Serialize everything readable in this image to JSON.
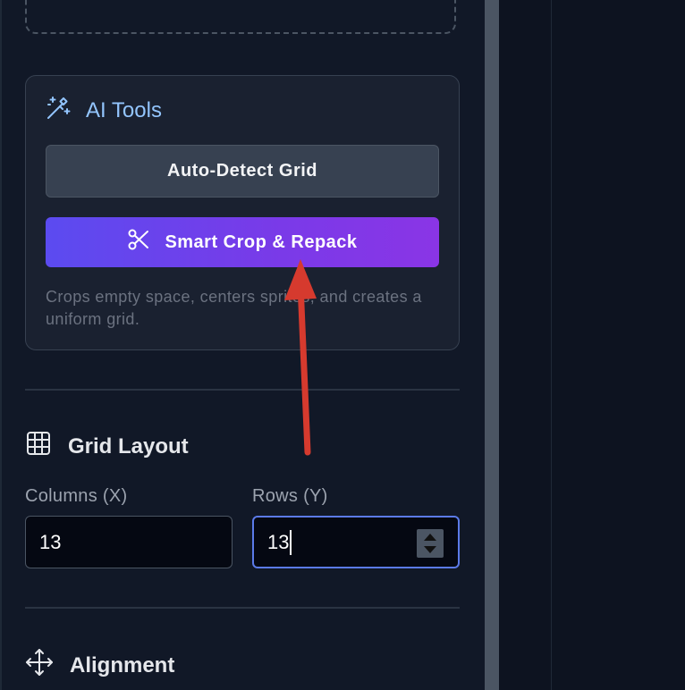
{
  "ai_tools": {
    "title": "AI Tools",
    "detect_label": "Auto-Detect Grid",
    "smart_label": "Smart Crop & Repack",
    "description": "Crops empty space, centers sprites, and creates a uniform grid."
  },
  "grid_layout": {
    "title": "Grid Layout",
    "columns_label": "Columns (X)",
    "columns_value": "13",
    "rows_label": "Rows (Y)",
    "rows_value": "13"
  },
  "alignment": {
    "title": "Alignment"
  },
  "icons": {
    "ai": "magic-wand-icon",
    "scissors": "scissors-icon",
    "grid": "grid-icon",
    "alignment": "move-icon"
  },
  "colors": {
    "accent_gradient_start": "#5b4bf0",
    "accent_gradient_end": "#8a35e6",
    "focus_border": "#5b7ae8",
    "annotation_arrow": "#d63a2e"
  }
}
